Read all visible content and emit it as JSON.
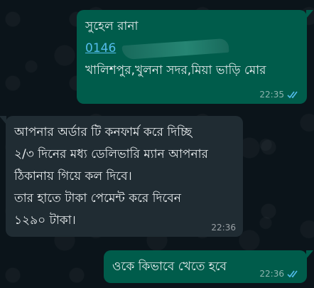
{
  "messages": [
    {
      "direction": "outgoing",
      "lines": [
        "সুহেল রানা",
        "",
        "খালিশপুর,খুলনা সদর,মিয়া ভাড়ি মোর"
      ],
      "phone_visible": "0146",
      "time": "22:35",
      "status": "read",
      "status_icon": "double-check-icon"
    },
    {
      "direction": "incoming",
      "lines": [
        "আপনার অর্ডার টি কনফার্ম করে দিচ্ছি",
        "২/৩ দিনের মধ্য ডেলিভারি ম্যান আপনার",
        "ঠিকানায় গিয়ে কল দিবে।",
        "তার হাতে টাকা পেমেন্ট করে দিবেন",
        "১২৯০ টাকা।"
      ],
      "time": "22:36"
    },
    {
      "direction": "outgoing",
      "lines": [
        "ওকে কিভাবে খেতে হবে"
      ],
      "time": "22:36",
      "status": "read",
      "status_icon": "double-check-icon"
    }
  ],
  "colors": {
    "outgoing_bubble": "#005c4b",
    "incoming_bubble": "#202c33",
    "read_ticks": "#53bdeb",
    "background": "#0b141a"
  }
}
